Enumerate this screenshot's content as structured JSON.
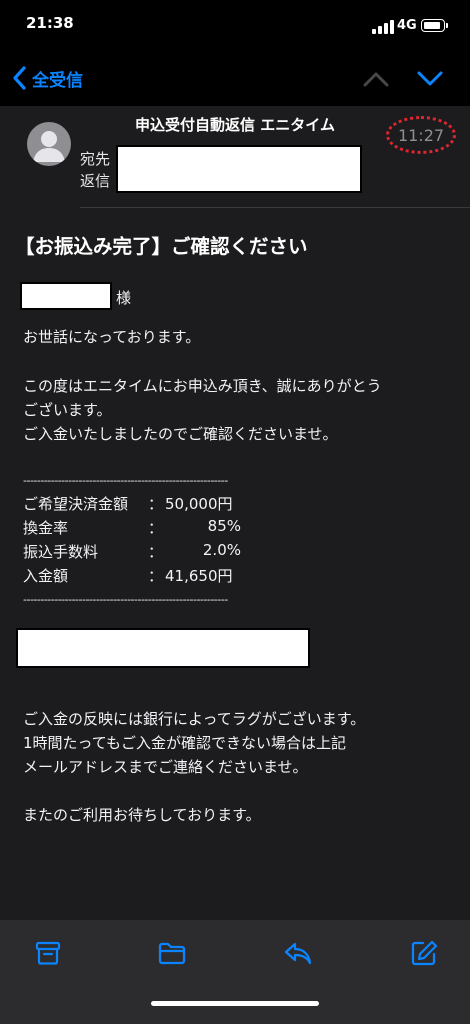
{
  "status_bar": {
    "time": "21:38",
    "network": "4G"
  },
  "nav": {
    "back_label": "全受信",
    "icons": {
      "back": "chevron-left-icon",
      "prev": "chevron-up-icon",
      "next": "chevron-down-icon"
    }
  },
  "header": {
    "sender": "申込受付自動返信 エニタイム",
    "time": "11:27",
    "to_label": "宛先",
    "reply_label": "返信"
  },
  "email": {
    "subject": "【お振込み完了】ご確認ください",
    "honorific": "様",
    "greeting": "お世話になっております。",
    "para1_line1": "この度はエニタイムにお申込み頂き、誠にありがとう",
    "para1_line2": "ございます。",
    "para1_line3": "ご入金いたしましたのでご確認くださいませ。",
    "divider": "-----------------------------------------------------------",
    "details": [
      {
        "label": "ご希望決済金額",
        "colon": "：",
        "value": "50,000円"
      },
      {
        "label": "換金率",
        "colon": "：",
        "value": "85%"
      },
      {
        "label": "振込手数料",
        "colon": "：",
        "value": "2.0%"
      },
      {
        "label": "入金額",
        "colon": "：",
        "value": "41,650円"
      }
    ],
    "para2_line1": "ご入金の反映には銀行によってラグがございます。",
    "para2_line2": "1時間たってもご入金が確認できない場合は上記",
    "para2_line3": "メールアドレスまでご連絡くださいませ。",
    "closing": "またのご利用お待ちしております。"
  },
  "toolbar": {
    "icons": [
      "archive-icon",
      "folder-icon",
      "reply-icon",
      "compose-icon"
    ]
  },
  "colors": {
    "accent": "#0a84ff",
    "background": "#1c1c1e",
    "badge_outline": "#e0262f"
  }
}
